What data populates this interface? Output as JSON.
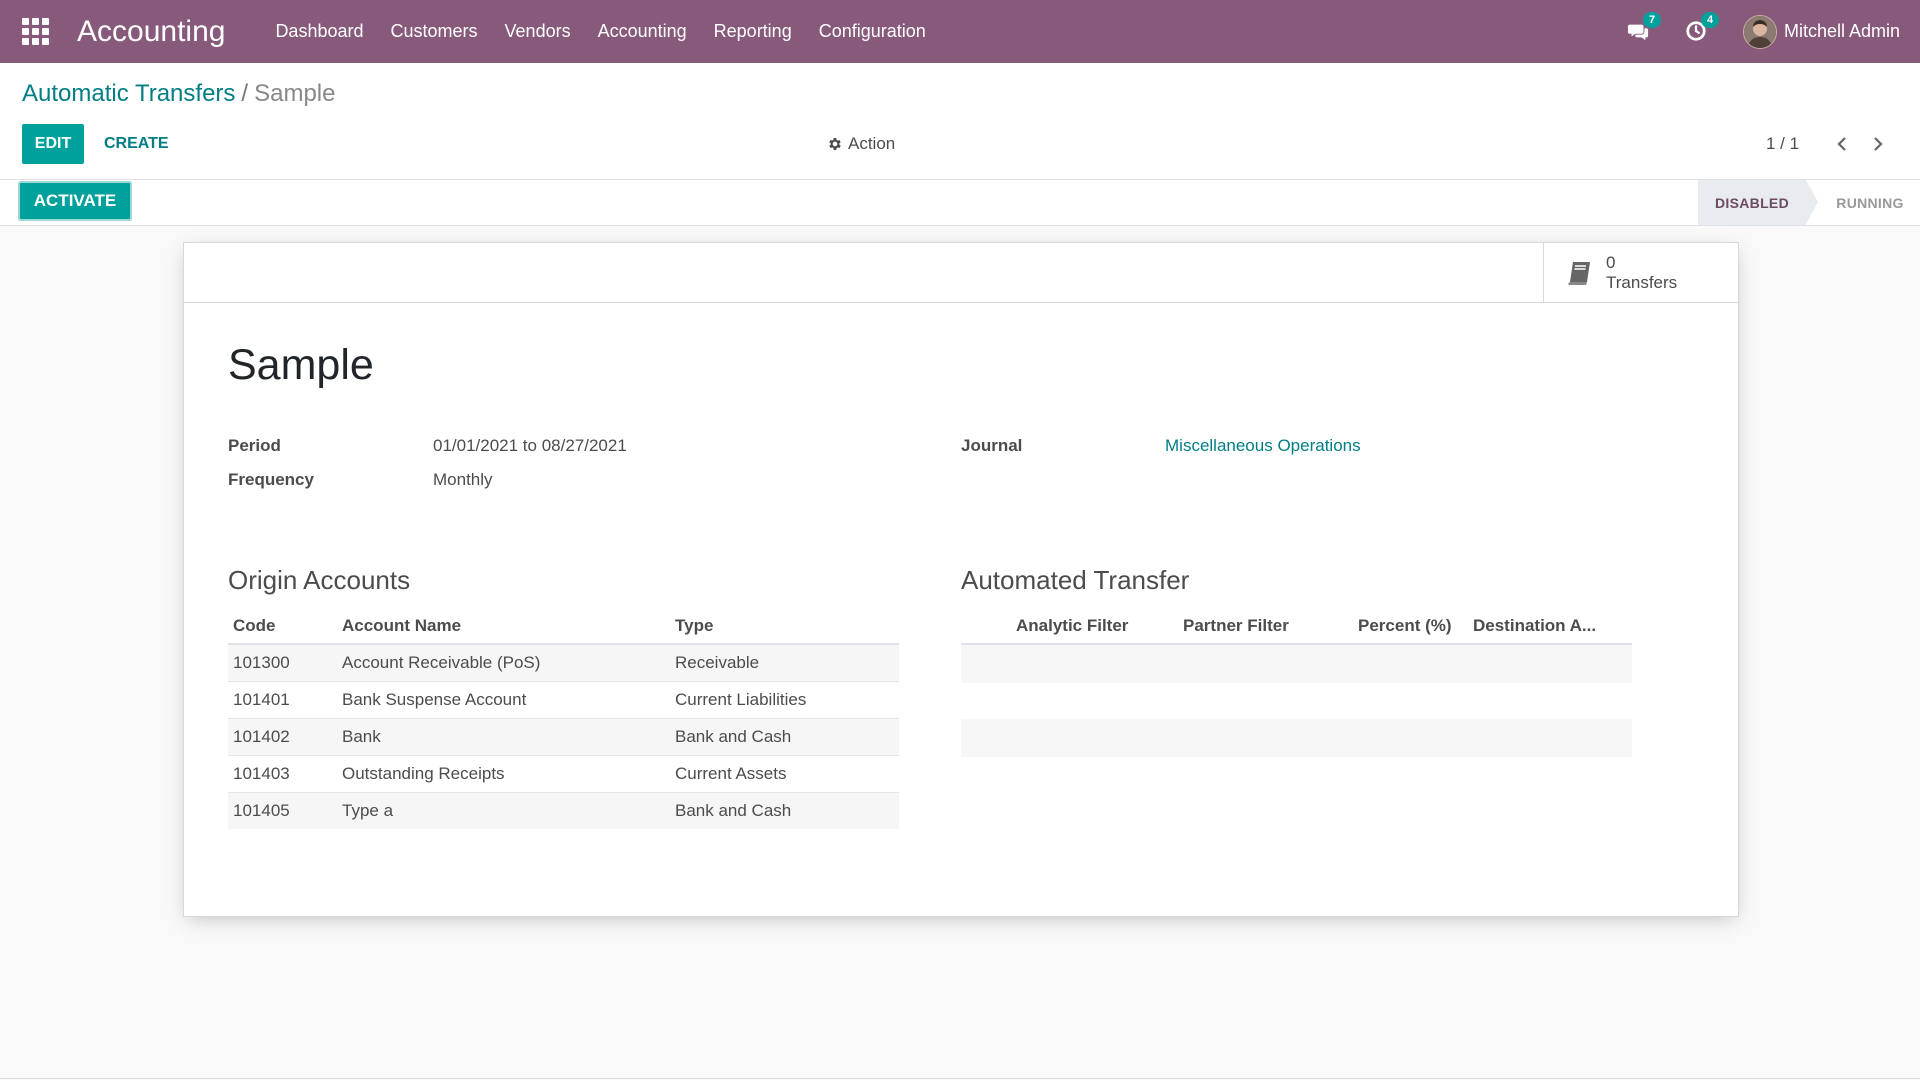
{
  "navbar": {
    "app_name": "Accounting",
    "menu": [
      "Dashboard",
      "Customers",
      "Vendors",
      "Accounting",
      "Reporting",
      "Configuration"
    ],
    "messages_count": "7",
    "activities_count": "4",
    "user_name": "Mitchell Admin",
    "color": "#875a7b"
  },
  "breadcrumb": {
    "parent": "Automatic Transfers",
    "current": "Sample"
  },
  "toolbar": {
    "edit_label": "EDIT",
    "create_label": "CREATE",
    "action_label": "Action",
    "pager": "1 / 1"
  },
  "statusbar": {
    "activate_label": "ACTIVATE",
    "stages": [
      "DISABLED",
      "RUNNING"
    ],
    "current_stage": "DISABLED"
  },
  "form": {
    "transfers_count": "0",
    "transfers_label": "Transfers",
    "title": "Sample",
    "period_label": "Period",
    "period_value": "01/01/2021 to 08/27/2021",
    "frequency_label": "Frequency",
    "frequency_value": "Monthly",
    "journal_label": "Journal",
    "journal_value": "Miscellaneous Operations"
  },
  "origin_accounts": {
    "title": "Origin Accounts",
    "columns": [
      "Code",
      "Account Name",
      "Type"
    ],
    "rows": [
      [
        "101300",
        "Account Receivable (PoS)",
        "Receivable"
      ],
      [
        "101401",
        "Bank Suspense Account",
        "Current Liabilities"
      ],
      [
        "101402",
        "Bank",
        "Bank and Cash"
      ],
      [
        "101403",
        "Outstanding Receipts",
        "Current Assets"
      ],
      [
        "101405",
        "Type a",
        "Bank and Cash"
      ]
    ]
  },
  "automated_transfer": {
    "title": "Automated Transfer",
    "columns": [
      "Analytic Filter",
      "Partner Filter",
      "Percent (%)",
      "Destination A..."
    ]
  },
  "colors": {
    "primary": "#00a09d",
    "link": "#017e84"
  }
}
